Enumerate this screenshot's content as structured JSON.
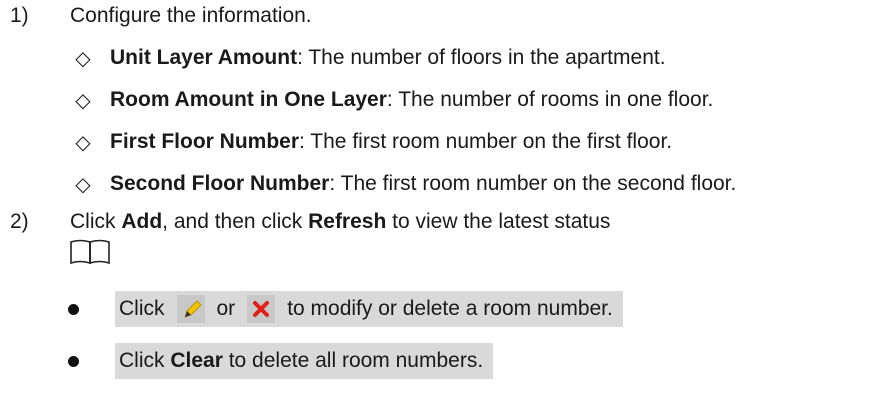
{
  "steps": [
    {
      "num": "1)",
      "text": "Configure the information."
    },
    {
      "num": "2)",
      "prefix": "Click ",
      "bold1": "Add",
      "middle": ", and then click ",
      "bold2": "Refresh",
      "suffix": " to view the latest status"
    }
  ],
  "sub_items": [
    {
      "bold": "Unit Layer Amount",
      "rest": ": The number of floors in the apartment."
    },
    {
      "bold": "Room Amount in One Layer",
      "rest": ": The number of rooms in one floor."
    },
    {
      "bold": "First Floor Number",
      "rest": ": The first room number on the first floor."
    },
    {
      "bold": "Second Floor Number",
      "rest": ": The first room number on the second floor."
    }
  ],
  "diamond_glyph": "◇",
  "note": {
    "icon": "book-icon",
    "items": [
      {
        "pre": "Click",
        "or": "or",
        "post": "to modify or delete a room number.",
        "icon1": "edit-pencil-icon",
        "icon2": "delete-x-icon"
      },
      {
        "pre": "Click ",
        "bold": "Clear",
        "post": " to delete all room numbers."
      }
    ]
  },
  "colors": {
    "highlight": "#d9d9d9",
    "pencil": "#f2c200",
    "delete": "#e0201b",
    "icon_bg": "#c8c8c8"
  }
}
